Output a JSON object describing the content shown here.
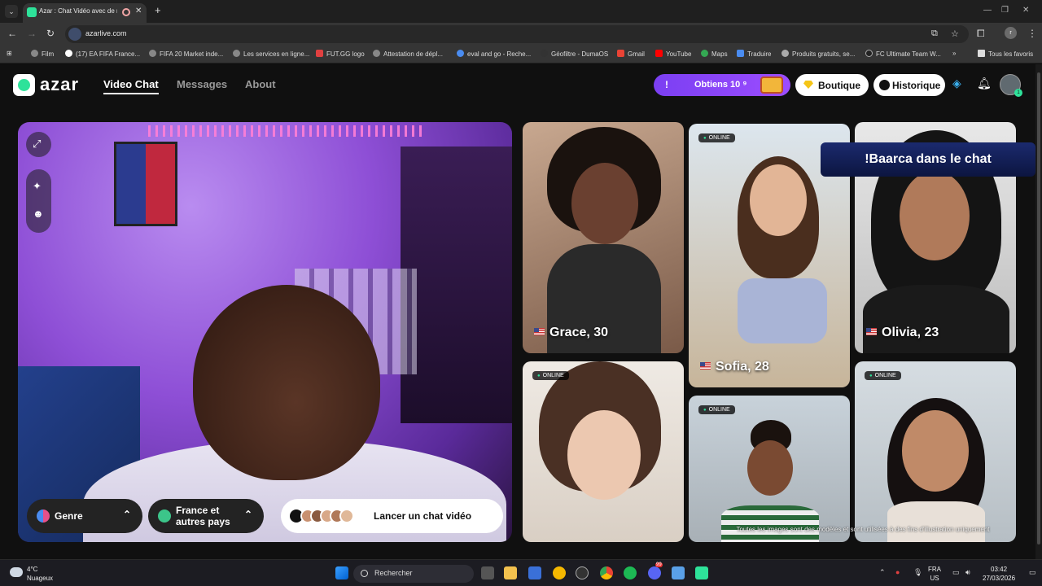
{
  "browser": {
    "tab_title": "Azar : Chat Vidéo avec de n",
    "url": "azarlive.com",
    "bookmarks": [
      "Film",
      "(17) EA FIFA France...",
      "FIFA 20 Market inde...",
      "Les services en ligne...",
      "FUT.GG logo",
      "Attestation de dépl...",
      "eval and go - Reche...",
      "Géofiltre - DumaOS",
      "Gmail",
      "YouTube",
      "Maps",
      "Traduire",
      "Produits gratuits, se...",
      "FC Ultimate Team W..."
    ],
    "all_bookmarks": "Tous les favoris",
    "profile_initial": "r"
  },
  "header": {
    "logo": "azar",
    "nav": [
      "Video Chat",
      "Messages",
      "About"
    ],
    "promo_exclaim": "!",
    "promo_label": "Obtiens 10 ⁹",
    "boutique": "Boutique",
    "historique": "Historique",
    "avatar_badge": "1"
  },
  "camera": {
    "genre": "Genre",
    "region": "France et autres pays",
    "launch": "Lancer un chat vidéo"
  },
  "cards": {
    "online_label": "ONLINE",
    "profiles": [
      {
        "name": "Grace, 30"
      },
      {
        "name": "Sofia, 28"
      },
      {
        "name": "Olivia, 23"
      }
    ]
  },
  "overlay": {
    "notice": "!Baarca dans le chat",
    "disclaimer": "Toutes les images sont des modèles et sont utilisées à des fins d'illustration uniquement"
  },
  "taskbar": {
    "temp": "4°C",
    "weather": "Nuageux",
    "search": "Rechercher",
    "lang1": "FRA",
    "lang2": "US",
    "time": "03:42",
    "date": "27/03/2026",
    "discord_badge": "99"
  },
  "colors": {
    "accent_green": "#2ee29a",
    "promo_purple": "#8a46f8"
  }
}
